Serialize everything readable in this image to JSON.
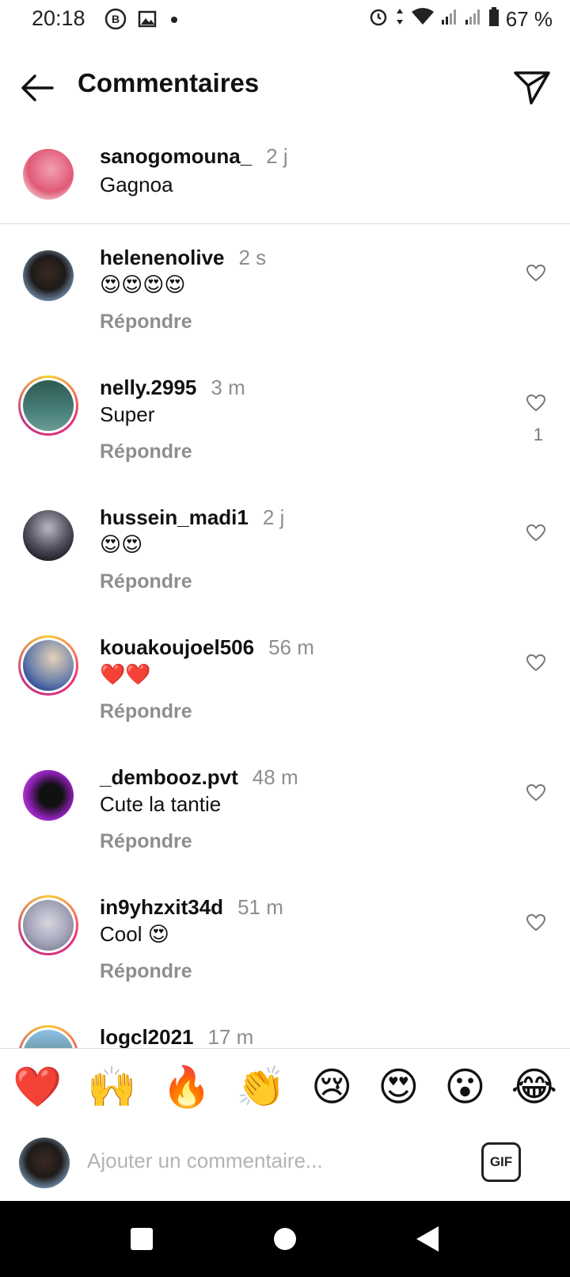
{
  "status_bar": {
    "time": "20:18",
    "battery": "67 %",
    "icons": [
      "b-circle-icon",
      "image-notification-icon",
      "dot-icon",
      "alarm-icon",
      "data-arrows-icon",
      "wifi-icon",
      "signal-icon",
      "signal-icon-2",
      "battery-icon"
    ]
  },
  "header": {
    "title": "Commentaires",
    "back_icon": "arrow-left-icon",
    "send_icon": "paper-plane-icon"
  },
  "caption": {
    "username": "sanogomouna_",
    "time": "2 j",
    "text": "Gagnoa"
  },
  "comments": [
    {
      "username": "helenenolive",
      "time": "2 s",
      "text": "😍😍😍😍",
      "reply": "Répondre",
      "likes": ""
    },
    {
      "username": "nelly.2995",
      "time": "3 m",
      "text": "Super",
      "reply": "Répondre",
      "likes": "1"
    },
    {
      "username": "hussein_madi1",
      "time": "2 j",
      "text": "😍😍",
      "reply": "Répondre",
      "likes": ""
    },
    {
      "username": "kouakoujoel506",
      "time": "56 m",
      "text": "❤️❤️",
      "reply": "Répondre",
      "likes": ""
    },
    {
      "username": "_dembooz.pvt",
      "time": "48 m",
      "text": "Cute la tantie",
      "reply": "Répondre",
      "likes": ""
    },
    {
      "username": "in9yhzxit34d",
      "time": "51 m",
      "text": "Cool 😍",
      "reply": "Répondre",
      "likes": ""
    },
    {
      "username": "logcl2021",
      "time": "17 m",
      "text": "",
      "reply": "",
      "likes": ""
    }
  ],
  "quick_reactions": [
    "❤️",
    "🙌",
    "🔥",
    "👏",
    "😢",
    "😍",
    "😮",
    "😂"
  ],
  "composer": {
    "placeholder": "Ajouter un commentaire...",
    "gif_label": "GIF"
  },
  "colors": {
    "muted": "#8e8e8e",
    "divider": "#dddddd",
    "story_ring_start": "#f9ce34",
    "story_ring_end": "#ee2a7b"
  }
}
